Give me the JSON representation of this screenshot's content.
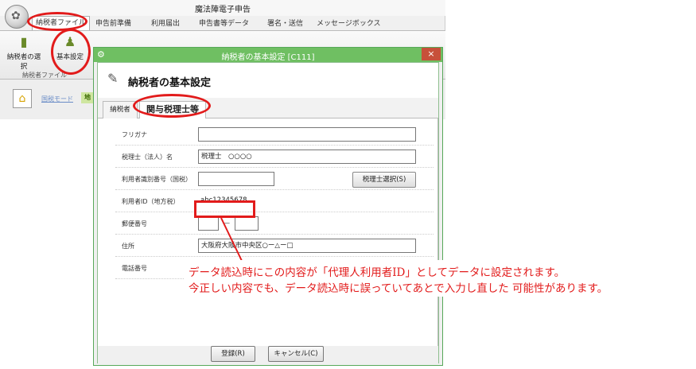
{
  "app": {
    "title": "魔法陣電子申告",
    "ribbon_tabs": [
      "納税者ファイル",
      "申告前準備",
      "利用届出",
      "申告書等データ",
      "署名・送信",
      "メッセージボックス"
    ],
    "ribbon_buttons": [
      {
        "label": "納税者の選択",
        "icon": "folder-user-icon"
      },
      {
        "label": "基本設定",
        "icon": "user-settings-icon"
      }
    ],
    "group_label": "納税者ファイル",
    "mode_label": "国税モード",
    "mode_extra": "地"
  },
  "dialog": {
    "title": "納税者の基本設定 [C111]",
    "close_glyph": "×",
    "header_title": "納税者の基本設定",
    "tabs": [
      "納税者",
      "関与税理士等"
    ],
    "fields": {
      "furigana_label": "フリガナ",
      "furigana_value": "",
      "name_label": "税理士（法人）名",
      "name_value": "税理士　○○○○",
      "user_id_national_label": "利用者識別番号（国税）",
      "user_id_national_value": "",
      "select_button": "税理士選択(S)",
      "user_id_local_label": "利用者ID（地方税）",
      "user_id_local_value": "abc12345678",
      "postal_label": "郵便番号",
      "postal_1": "",
      "postal_sep": "—",
      "postal_2": "",
      "address_label": "住所",
      "address_value": "大阪府大阪市中央区○ー△ー□",
      "phone_label": "電話番号"
    },
    "buttons": {
      "register": "登録(R)",
      "cancel": "キャンセル(C)"
    }
  },
  "annotation": {
    "line1": "データ読込時にこの内容が「代理人利用者ID」としてデータに設定されます。",
    "line2": "今正しい内容でも、データ読込時に誤っていてあとで入力し直した 可能性があります。",
    "color": "#e21b1b"
  }
}
